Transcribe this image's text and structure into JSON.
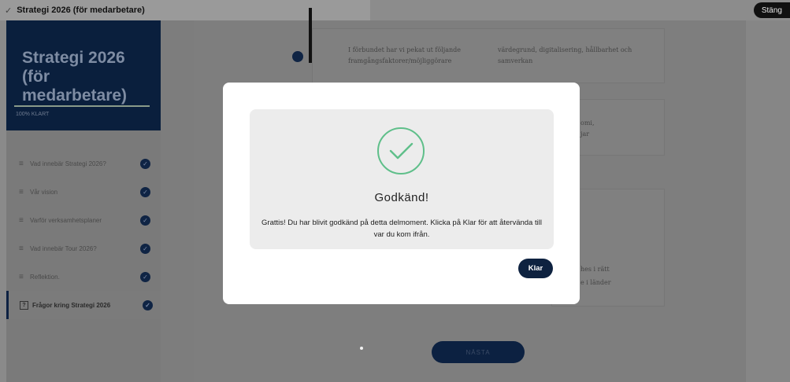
{
  "window": {
    "title": "Strategi 2026 (för medarbetare)",
    "close_label": "Stäng"
  },
  "sidebar": {
    "course_title": "Strategi 2026 (för medarbetare)",
    "progress": {
      "value": 1.0,
      "label": "100% KLART"
    },
    "items": [
      {
        "label": "Vad innebär Strategi 2026?",
        "completed": true
      },
      {
        "label": "Vår vision",
        "completed": true
      },
      {
        "label": "Varför verksamhetsplaner",
        "completed": true
      },
      {
        "label": "Vad innebär Tour 2026?",
        "completed": true
      },
      {
        "label": "Reflektion.",
        "completed": true
      },
      {
        "label": "Frågor kring Strategi 2026",
        "completed": true,
        "active": true
      }
    ]
  },
  "main": {
    "row1": {
      "left_text": "I förbundet har vi pekat ut följande framgångsfaktorer/möjliggörare",
      "right_text": "värdegrund, digitalisering, hållbarhet och samverkan"
    },
    "row2": {
      "fragment1": "omi,",
      "fragment2": "jar"
    },
    "row3": {
      "fragment1": "hes i rätt",
      "fragment2": "e i länder"
    },
    "next_label": "NÄSTA"
  },
  "modal": {
    "title": "Godkänd!",
    "message": "Grattis! Du har blivit godkänd på detta delmoment. Klicka på Klar för att återvända till var du kom ifrån.",
    "button_label": "Klar",
    "colors": {
      "check": "#5fbf8a",
      "button": "#0e2240"
    }
  }
}
